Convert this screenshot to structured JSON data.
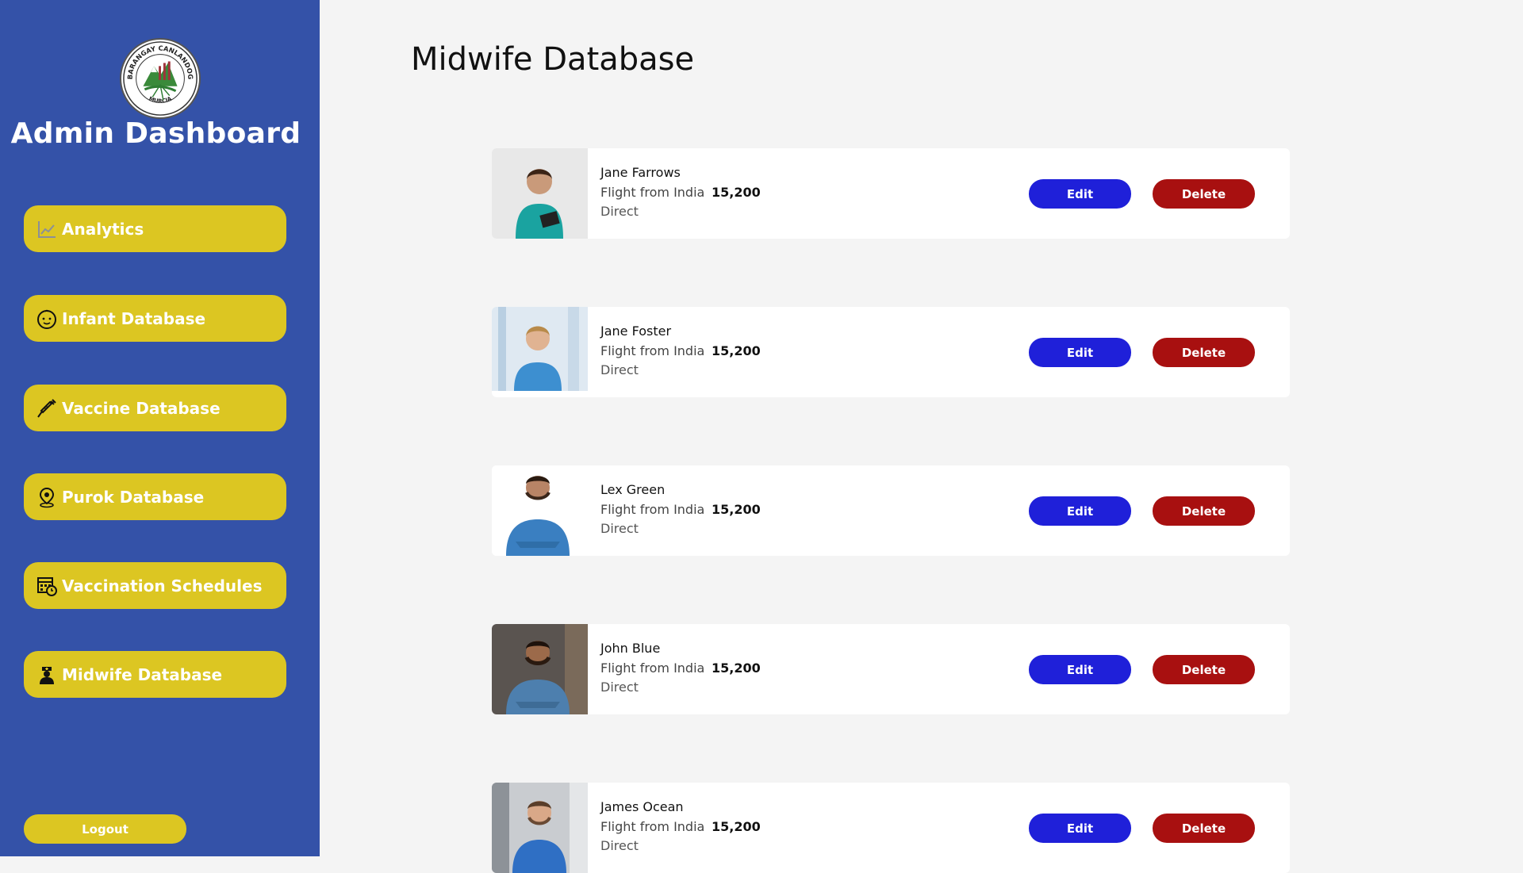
{
  "sidebar": {
    "title": "Admin Dashboard",
    "logo": {
      "top_text": "BARANGAY CANLANDOG",
      "bottom_text": "MURCIA"
    },
    "items": [
      {
        "label": "Analytics",
        "icon": "chart-line-icon"
      },
      {
        "label": "Infant Database",
        "icon": "baby-face-icon"
      },
      {
        "label": "Vaccine Database",
        "icon": "syringe-icon"
      },
      {
        "label": "Purok Database",
        "icon": "map-pin-icon"
      },
      {
        "label": "Vaccination Schedules",
        "icon": "calendar-clock-icon"
      },
      {
        "label": "Midwife Database",
        "icon": "nurse-icon"
      }
    ],
    "logout_label": "Logout"
  },
  "main": {
    "title": "Midwife Database",
    "midwives": [
      {
        "name": "Jane Farrows",
        "route": "Flight from India",
        "price": "15,200",
        "stops": "Direct",
        "photo": "female-nurse-teal-scrubs"
      },
      {
        "name": "Jane Foster",
        "route": "Flight from India",
        "price": "15,200",
        "stops": "Direct",
        "photo": "female-nurse-blue-scrubs"
      },
      {
        "name": "Lex Green",
        "route": "Flight from India",
        "price": "15,200",
        "stops": "Direct",
        "photo": "male-nurse-blue-scrubs"
      },
      {
        "name": "John Blue",
        "route": "Flight from India",
        "price": "15,200",
        "stops": "Direct",
        "photo": "male-nurse-blue-scrubs-dark-bg"
      },
      {
        "name": "James Ocean",
        "route": "Flight from India",
        "price": "15,200",
        "stops": "Direct",
        "photo": "male-nurse-blue-scrubs-hallway"
      }
    ],
    "edit_label": "Edit",
    "delete_label": "Delete"
  },
  "colors": {
    "sidebar_bg": "#3452a8",
    "nav_button": "#dcc622",
    "edit_button": "#1f20d9",
    "delete_button": "#a81010",
    "page_bg": "#f4f4f4"
  }
}
